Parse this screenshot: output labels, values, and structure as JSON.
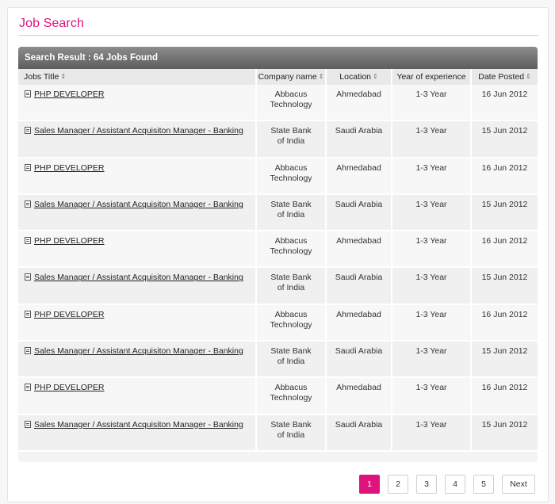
{
  "page": {
    "title": "Job Search"
  },
  "results": {
    "header": "Search Result : 64 Jobs Found",
    "columns": [
      "Jobs Title",
      "Company name",
      "Location",
      "Year of experience",
      "Date Posted"
    ],
    "rows": [
      {
        "title": "PHP DEVELOPER",
        "company": [
          "Abbacus",
          "Technology"
        ],
        "location": "Ahmedabad",
        "experience": "1-3 Year",
        "date": "16 Jun 2012"
      },
      {
        "title": "Sales Manager / Assistant Acquisiton Manager - Banking",
        "company": [
          "State Bank",
          "of India"
        ],
        "location": "Saudi Arabia",
        "experience": "1-3 Year",
        "date": "15 Jun 2012"
      },
      {
        "title": "PHP DEVELOPER",
        "company": [
          "Abbacus",
          "Technology"
        ],
        "location": "Ahmedabad",
        "experience": "1-3 Year",
        "date": "16 Jun 2012"
      },
      {
        "title": "Sales Manager / Assistant Acquisiton Manager - Banking",
        "company": [
          "State Bank",
          "of India"
        ],
        "location": "Saudi Arabia",
        "experience": "1-3 Year",
        "date": "15 Jun 2012"
      },
      {
        "title": "PHP DEVELOPER",
        "company": [
          "Abbacus",
          "Technology"
        ],
        "location": "Ahmedabad",
        "experience": "1-3 Year",
        "date": "16 Jun 2012"
      },
      {
        "title": "Sales Manager / Assistant Acquisiton Manager - Banking",
        "company": [
          "State Bank",
          "of India"
        ],
        "location": "Saudi Arabia",
        "experience": "1-3 Year",
        "date": "15 Jun 2012"
      },
      {
        "title": "PHP DEVELOPER",
        "company": [
          "Abbacus",
          "Technology"
        ],
        "location": "Ahmedabad",
        "experience": "1-3 Year",
        "date": "16 Jun 2012"
      },
      {
        "title": "Sales Manager / Assistant Acquisiton Manager - Banking",
        "company": [
          "State Bank",
          "of India"
        ],
        "location": "Saudi Arabia",
        "experience": "1-3 Year",
        "date": "15 Jun 2012"
      },
      {
        "title": "PHP DEVELOPER",
        "company": [
          "Abbacus",
          "Technology"
        ],
        "location": "Ahmedabad",
        "experience": "1-3 Year",
        "date": "16 Jun 2012"
      },
      {
        "title": "Sales Manager / Assistant Acquisiton Manager - Banking",
        "company": [
          "State Bank",
          "of India"
        ],
        "location": "Saudi Arabia",
        "experience": "1-3 Year",
        "date": "15 Jun 2012"
      }
    ]
  },
  "pagination": {
    "pages": [
      "1",
      "2",
      "3",
      "4",
      "5"
    ],
    "active": "1",
    "next_label": "Next"
  },
  "icons": {
    "sort": "sort-icon",
    "document": "document-icon"
  },
  "colors": {
    "accent": "#e0127c",
    "header_bar": "#6e6e6e"
  }
}
